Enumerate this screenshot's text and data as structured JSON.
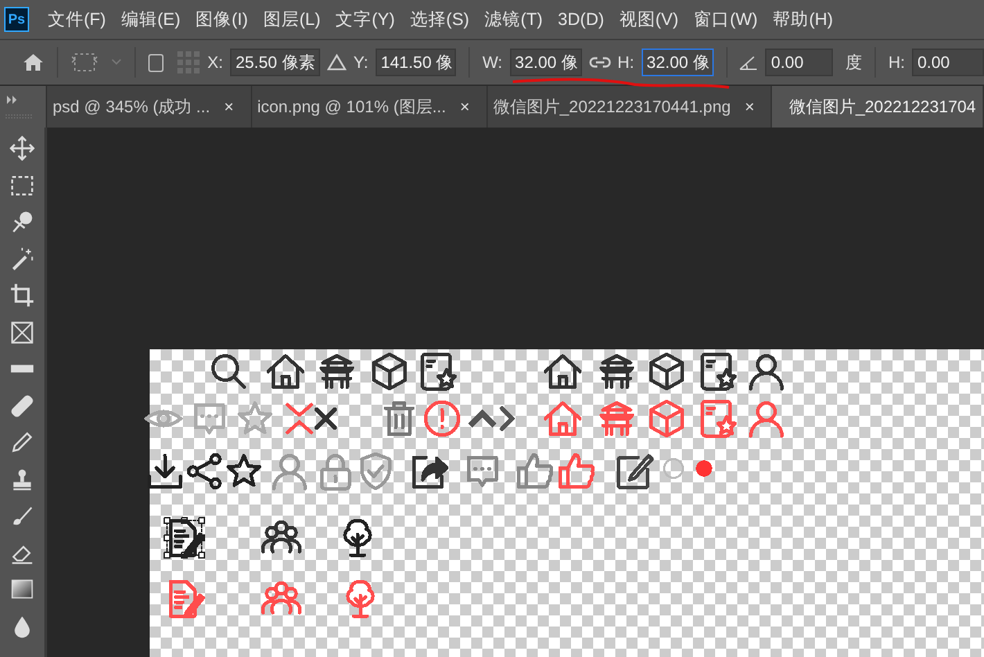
{
  "app": {
    "logo": "Ps"
  },
  "menu": [
    "文件(F)",
    "编辑(E)",
    "图像(I)",
    "图层(L)",
    "文字(Y)",
    "选择(S)",
    "滤镜(T)",
    "3D(D)",
    "视图(V)",
    "窗口(W)",
    "帮助(H)"
  ],
  "options_bar": {
    "checkbox": {
      "checked": false
    },
    "x": {
      "label": "X:",
      "value": "25.50 像素",
      "focused": false
    },
    "y": {
      "label": "Y:",
      "value": "141.50 像",
      "focused": false
    },
    "w": {
      "label": "W:",
      "value": "32.00 像",
      "focused": false
    },
    "h": {
      "label": "H:",
      "value": "32.00 像",
      "focused": true
    },
    "angle": {
      "value": "0.00",
      "unit": "度",
      "focused": false
    },
    "skew": {
      "label": "H:",
      "value": "0.00",
      "focused": false
    }
  },
  "tabs": [
    {
      "label": "psd @ 345% (成功 ...",
      "close": "×",
      "selected": false
    },
    {
      "label": "icon.png @ 101% (图层...",
      "close": "×",
      "selected": false
    },
    {
      "label": "微信图片_20221223170441.png",
      "close": "×",
      "selected": false
    },
    {
      "label": "微信图片_202212231704",
      "selected": true
    }
  ],
  "canvas_icons": [
    {
      "kind": "search",
      "color": "#333333",
      "selected": false
    },
    {
      "kind": "house",
      "color": "#333333",
      "selected": false
    },
    {
      "kind": "pagoda",
      "color": "#333333",
      "selected": false
    },
    {
      "kind": "cube",
      "color": "#333333",
      "selected": false
    },
    {
      "kind": "docstar",
      "color": "#333333",
      "selected": false
    },
    {
      "kind": "house",
      "color": "#333333",
      "selected": false
    },
    {
      "kind": "pagoda",
      "color": "#333333",
      "selected": false
    },
    {
      "kind": "cube",
      "color": "#333333",
      "selected": false
    },
    {
      "kind": "docstar",
      "color": "#333333",
      "selected": false
    },
    {
      "kind": "person",
      "color": "#333333",
      "selected": false
    },
    {
      "kind": "eye",
      "color": "#aaaaaa",
      "selected": false
    },
    {
      "kind": "chat",
      "color": "#aaaaaa",
      "selected": false
    },
    {
      "kind": "star",
      "color": "#aaaaaa",
      "selected": false
    },
    {
      "kind": "chevrons",
      "color": "#ff4d4d",
      "selected": false
    },
    {
      "kind": "x",
      "color": "#333333",
      "selected": false
    },
    {
      "kind": "trash",
      "color": "#777777",
      "selected": false
    },
    {
      "kind": "alert",
      "color": "#ff4d4d",
      "selected": false
    },
    {
      "kind": "caret-up",
      "color": "#555555",
      "selected": false
    },
    {
      "kind": "caret-right",
      "color": "#555555",
      "selected": false
    },
    {
      "kind": "house",
      "color": "#ff4d4d",
      "selected": false
    },
    {
      "kind": "pagoda",
      "color": "#ff4d4d",
      "selected": false
    },
    {
      "kind": "cube",
      "color": "#ff4d4d",
      "selected": false
    },
    {
      "kind": "docstar",
      "color": "#ff4d4d",
      "selected": false
    },
    {
      "kind": "person",
      "color": "#ff4d4d",
      "selected": false
    },
    {
      "kind": "download",
      "color": "#222222",
      "selected": false
    },
    {
      "kind": "share",
      "color": "#222222",
      "selected": false
    },
    {
      "kind": "star",
      "color": "#222222",
      "selected": false
    },
    {
      "kind": "person",
      "color": "#999999",
      "selected": false
    },
    {
      "kind": "lock",
      "color": "#999999",
      "selected": false
    },
    {
      "kind": "shield",
      "color": "#999999",
      "selected": false
    },
    {
      "kind": "sharebox",
      "color": "#333333",
      "selected": false
    },
    {
      "kind": "chat",
      "color": "#888888",
      "selected": false
    },
    {
      "kind": "thumb",
      "color": "#888888",
      "selected": false
    },
    {
      "kind": "thumb",
      "color": "#ff4d4d",
      "selected": false
    },
    {
      "kind": "edit",
      "color": "#444444",
      "selected": false
    },
    {
      "kind": "radio",
      "color": "#bbbbbb",
      "selected": false
    },
    {
      "kind": "radio-dot",
      "color": "#ff3333",
      "selected": false
    },
    {
      "kind": "docedit",
      "color": "#222222",
      "selected": true
    },
    {
      "kind": "people",
      "color": "#333333",
      "selected": false
    },
    {
      "kind": "tree",
      "color": "#222222",
      "selected": false
    },
    {
      "kind": "docedit",
      "color": "#ff4d4d",
      "selected": false
    },
    {
      "kind": "people",
      "color": "#ff4d4d",
      "selected": false
    },
    {
      "kind": "tree",
      "color": "#ff4d4d",
      "selected": false
    }
  ]
}
